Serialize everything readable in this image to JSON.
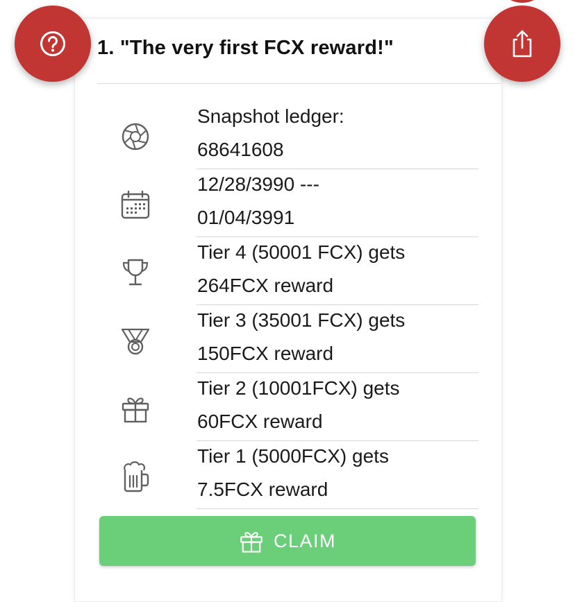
{
  "card": {
    "title": "1. \"The very first FCX reward!\""
  },
  "actions": {
    "help_icon": "question-circle-icon",
    "share_icon": "share-icon"
  },
  "rows": [
    {
      "icon": "aperture-icon",
      "line1": "Snapshot ledger:",
      "line2": "68641608"
    },
    {
      "icon": "calendar-icon",
      "line1": "12/28/3990 ---",
      "line2": "01/04/3991"
    },
    {
      "icon": "trophy-icon",
      "line1": "Tier 4 (50001 FCX) gets",
      "line2": "264FCX reward"
    },
    {
      "icon": "medal-icon",
      "line1": "Tier 3 (35001 FCX) gets",
      "line2": "150FCX reward"
    },
    {
      "icon": "gift-icon",
      "line1": "Tier 2 (10001FCX) gets",
      "line2": "60FCX reward"
    },
    {
      "icon": "beer-mug-icon",
      "line1": "Tier 1 (5000FCX) gets",
      "line2": "7.5FCX reward"
    }
  ],
  "claim_button": {
    "label": "CLAIM",
    "icon": "gift-icon"
  },
  "colors": {
    "fab_red": "#c13533",
    "claim_green": "#6bcf7a",
    "icon_gray": "#5f5f5f"
  }
}
